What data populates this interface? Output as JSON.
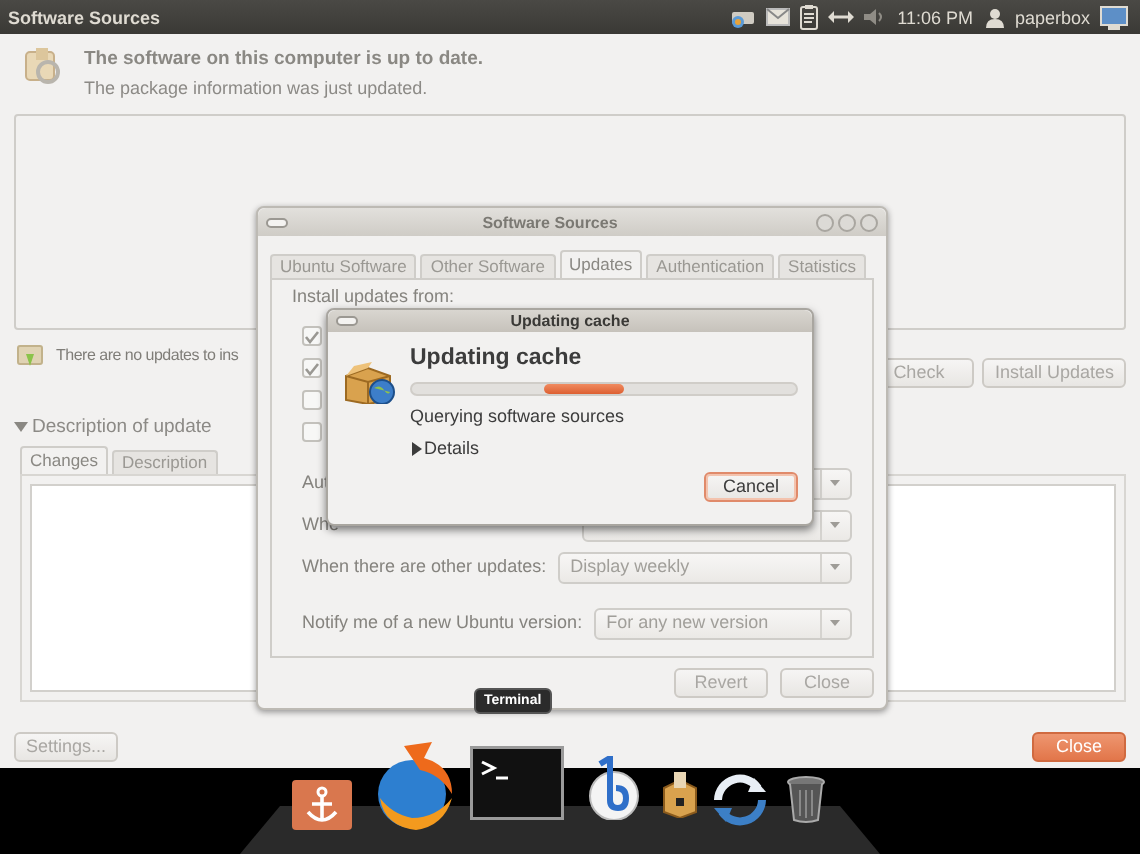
{
  "top_panel": {
    "title": "Software Sources",
    "clock": "11:06 PM",
    "user": "paperbox"
  },
  "update_manager": {
    "heading": "The software on this computer is up to date.",
    "subheading": "The package information was just updated.",
    "status": "There are no updates to ins",
    "buttons": [
      "Check",
      "Install Updates"
    ],
    "expander": {
      "label": "Description of update",
      "expanded": true
    },
    "tabs": [
      {
        "label": "Changes",
        "selected": true
      },
      {
        "label": "Description",
        "selected": false
      }
    ],
    "settings_button": "Settings...",
    "close_button": "Close"
  },
  "software_sources": {
    "title": "Software Sources",
    "tabs": [
      {
        "label": "Ubuntu Software",
        "selected": false
      },
      {
        "label": "Other Software",
        "selected": false
      },
      {
        "label": "Updates",
        "selected": true
      },
      {
        "label": "Authentication",
        "selected": false
      },
      {
        "label": "Statistics",
        "selected": false
      }
    ],
    "install_label": "Install updates from:",
    "sources": [
      {
        "checked": true
      },
      {
        "checked": true
      },
      {
        "checked": false
      },
      {
        "checked": false
      }
    ],
    "options": [
      {
        "label": "Aut"
      },
      {
        "label": "Whe"
      },
      {
        "label": "When there are other updates:",
        "value": "Display weekly"
      },
      {
        "label": "Notify me of a new Ubuntu version:",
        "value": "For any new version"
      }
    ],
    "buttons": [
      "Revert",
      "Close"
    ]
  },
  "dialog": {
    "title": "Updating cache",
    "heading": "Updating cache",
    "status": "Querying software sources",
    "details": {
      "label": "Details",
      "expanded": false
    },
    "cancel": "Cancel"
  },
  "tooltip": "Terminal"
}
